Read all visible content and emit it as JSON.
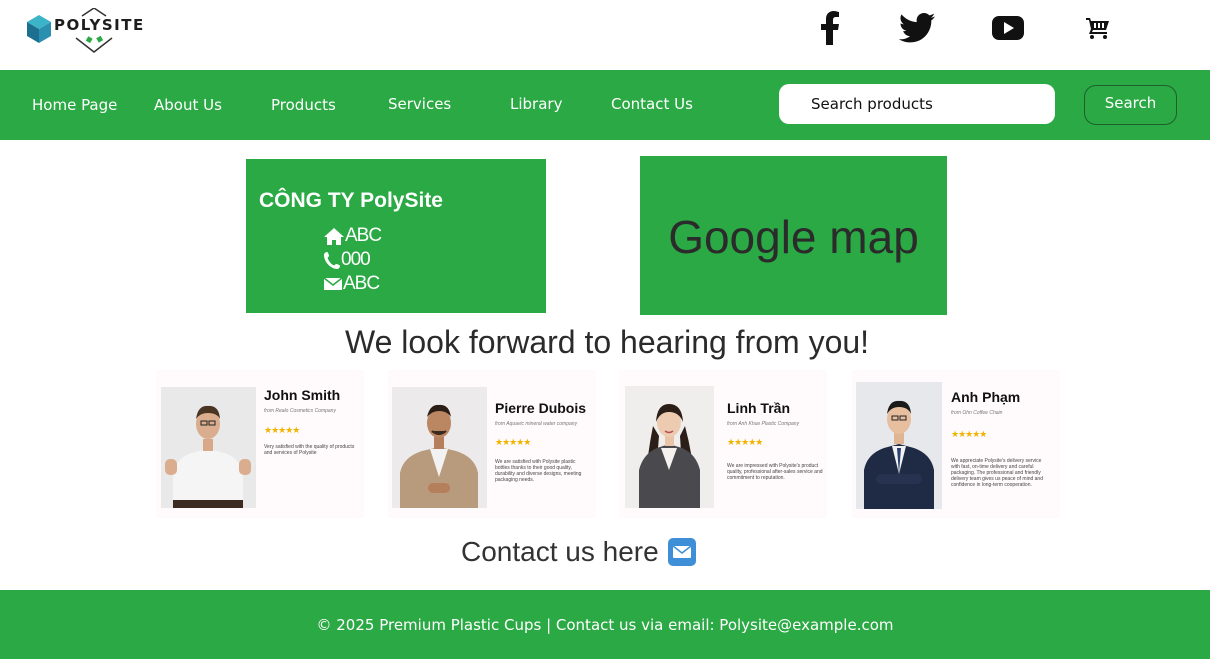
{
  "logo": {
    "text": "POLYSITE"
  },
  "social": {
    "icons": [
      "facebook-icon",
      "twitter-icon",
      "youtube-icon",
      "cart-icon"
    ]
  },
  "nav": {
    "items": [
      "Home Page",
      "About Us",
      "Products",
      "Services",
      "Library",
      "Contact Us"
    ],
    "search_placeholder": "Search products",
    "search_button": "Search"
  },
  "company": {
    "title": "CÔNG TY PolySite",
    "address": "ABC",
    "phone": "000",
    "email": "ABC"
  },
  "map": {
    "label": "Google map"
  },
  "tagline": "We look forward to hearing from you!",
  "testimonials": [
    {
      "name": "John Smith",
      "company": "from Realo Cosmetics Company",
      "stars": "★★★★★",
      "quote": "Very satisfied with the quality of products and services of Polysite"
    },
    {
      "name": "Pierre Dubois",
      "company": "from Aquavic mineral water company",
      "stars": "★★★★★",
      "quote": "We are satisfied with Polysite plastic bottles thanks to their good quality, durability and diverse designs, meeting packaging needs."
    },
    {
      "name": "Linh Trần",
      "company": "from Anh Khue Plastic Company",
      "stars": "★★★★★",
      "quote": "We are impressed with Polysite's product quality, professional after-sales service and commitment to reputation."
    },
    {
      "name": "Anh Phạm",
      "company": "from Ohn Coffee Chain",
      "stars": "★★★★★",
      "quote": "We appreciate Polysite's delivery service with fast, on-time delivery and careful packaging. The professional and friendly delivery team gives us peace of mind and confidence in long-term cooperation."
    }
  ],
  "contact_cta": "Contact us here",
  "footer": {
    "text": "© 2025 Premium Plastic Cups | Contact us via email: Polysite@example.com"
  },
  "colors": {
    "brand_green": "#2aa944",
    "star": "#f0b400"
  }
}
